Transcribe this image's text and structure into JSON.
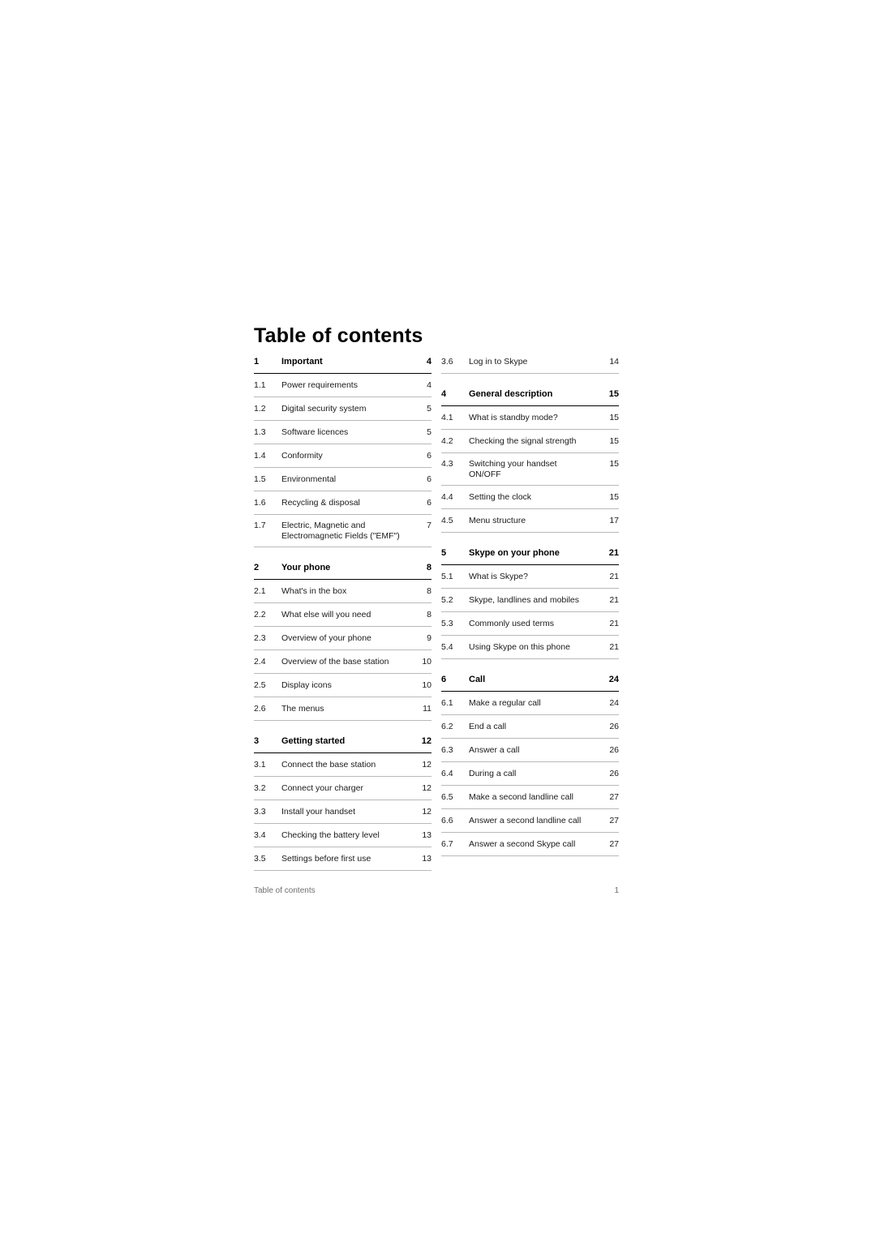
{
  "document": {
    "title": "Table of contents",
    "footer_left": "Table of contents",
    "footer_right": "1"
  },
  "toc": {
    "left_column": [
      {
        "num": "1",
        "label": "Important",
        "page": "4",
        "type": "section"
      },
      {
        "num": "1.1",
        "label": "Power requirements",
        "page": "4",
        "type": "entry"
      },
      {
        "num": "1.2",
        "label": "Digital security system",
        "page": "5",
        "type": "entry"
      },
      {
        "num": "1.3",
        "label": "Software licences",
        "page": "5",
        "type": "entry"
      },
      {
        "num": "1.4",
        "label": "Conformity",
        "page": "6",
        "type": "entry"
      },
      {
        "num": "1.5",
        "label": "Environmental",
        "page": "6",
        "type": "entry"
      },
      {
        "num": "1.6",
        "label": "Recycling & disposal",
        "page": "6",
        "type": "entry"
      },
      {
        "num": "1.7",
        "label": "Electric, Magnetic and",
        "label2": "Electromagnetic Fields (\"EMF\")",
        "page": "7",
        "type": "entry2"
      },
      {
        "num": "2",
        "label": "Your phone",
        "page": "8",
        "type": "section"
      },
      {
        "num": "2.1",
        "label": "What's in the box",
        "page": "8",
        "type": "entry"
      },
      {
        "num": "2.2",
        "label": "What else will you need",
        "page": "8",
        "type": "entry"
      },
      {
        "num": "2.3",
        "label": "Overview of your phone",
        "page": "9",
        "type": "entry"
      },
      {
        "num": "2.4",
        "label": "Overview of the base station",
        "page": "10",
        "type": "entry"
      },
      {
        "num": "2.5",
        "label": "Display icons",
        "page": "10",
        "type": "entry"
      },
      {
        "num": "2.6",
        "label": "The menus",
        "page": "11",
        "type": "entry"
      },
      {
        "num": "3",
        "label": "Getting started",
        "page": "12",
        "type": "section"
      },
      {
        "num": "3.1",
        "label": "Connect the base station",
        "page": "12",
        "type": "entry"
      },
      {
        "num": "3.2",
        "label": "Connect your charger",
        "page": "12",
        "type": "entry"
      },
      {
        "num": "3.3",
        "label": "Install your handset",
        "page": "12",
        "type": "entry"
      },
      {
        "num": "3.4",
        "label": "Checking the battery level",
        "page": "13",
        "type": "entry"
      },
      {
        "num": "3.5",
        "label": "Settings before first use",
        "page": "13",
        "type": "entry"
      }
    ],
    "right_column": [
      {
        "num": "3.6",
        "label": "Log in to Skype",
        "page": "14",
        "type": "entry"
      },
      {
        "num": "4",
        "label": "General description",
        "page": "15",
        "type": "section"
      },
      {
        "num": "4.1",
        "label": "What is standby mode?",
        "page": "15",
        "type": "entry"
      },
      {
        "num": "4.2",
        "label": "Checking the signal strength",
        "page": "15",
        "type": "entry"
      },
      {
        "num": "4.3",
        "label": "Switching your handset",
        "label2": "ON/OFF",
        "page": "15",
        "type": "entry2"
      },
      {
        "num": "4.4",
        "label": "Setting the clock",
        "page": "15",
        "type": "entry"
      },
      {
        "num": "4.5",
        "label": "Menu structure",
        "page": "17",
        "type": "entry"
      },
      {
        "num": "5",
        "label": "Skype on your phone",
        "page": "21",
        "type": "section"
      },
      {
        "num": "5.1",
        "label": "What is Skype?",
        "page": "21",
        "type": "entry"
      },
      {
        "num": "5.2",
        "label": "Skype, landlines and mobiles",
        "page": "21",
        "type": "entry"
      },
      {
        "num": "5.3",
        "label": "Commonly used terms",
        "page": "21",
        "type": "entry"
      },
      {
        "num": "5.4",
        "label": "Using Skype on this phone",
        "page": "21",
        "type": "entry"
      },
      {
        "num": "6",
        "label": "Call",
        "page": "24",
        "type": "section"
      },
      {
        "num": "6.1",
        "label": "Make a regular call",
        "page": "24",
        "type": "entry"
      },
      {
        "num": "6.2",
        "label": "End a call",
        "page": "26",
        "type": "entry"
      },
      {
        "num": "6.3",
        "label": "Answer a call",
        "page": "26",
        "type": "entry"
      },
      {
        "num": "6.4",
        "label": "During a call",
        "page": "26",
        "type": "entry"
      },
      {
        "num": "6.5",
        "label": "Make a second landline call",
        "page": "27",
        "type": "entry"
      },
      {
        "num": "6.6",
        "label": "Answer a second landline call",
        "page": "27",
        "type": "entry"
      },
      {
        "num": "6.7",
        "label": "Answer a second Skype call",
        "page": "27",
        "type": "entry"
      }
    ]
  }
}
